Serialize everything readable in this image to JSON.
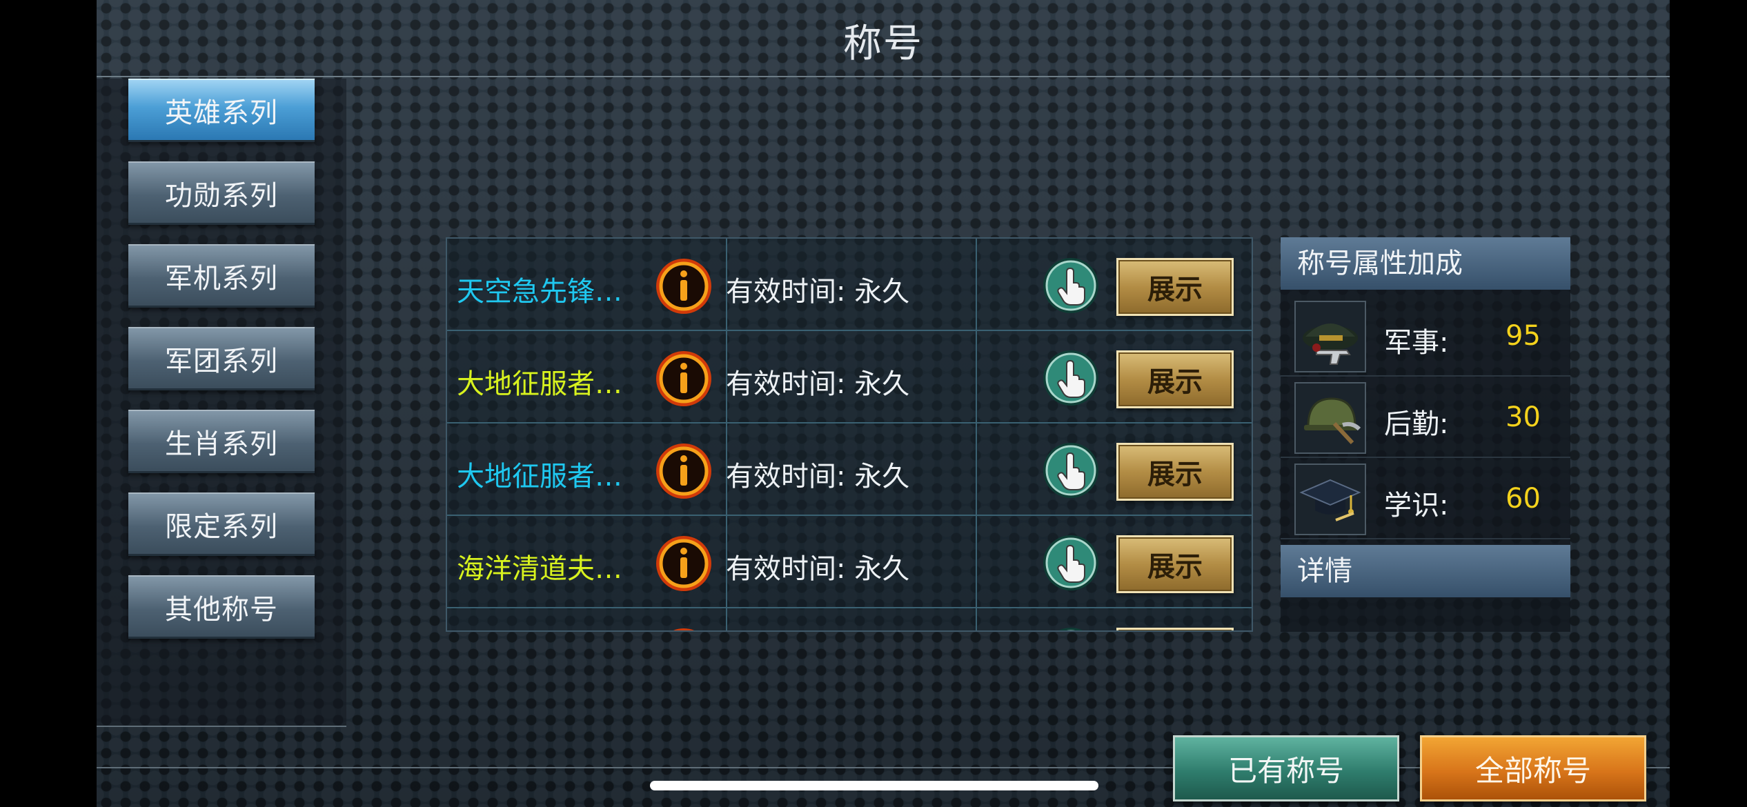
{
  "header": {
    "title": "称号",
    "close_icon": "close-x-icon"
  },
  "sidebar": {
    "items": [
      {
        "label": "英雄系列",
        "active": true
      },
      {
        "label": "功勋系列",
        "active": false
      },
      {
        "label": "军机系列",
        "active": false
      },
      {
        "label": "军团系列",
        "active": false
      },
      {
        "label": "生肖系列",
        "active": false
      },
      {
        "label": "限定系列",
        "active": false
      },
      {
        "label": "其他称号",
        "active": false
      }
    ]
  },
  "titles": {
    "rows": [
      {
        "name": "天空急先锋…",
        "name_color": "cyan",
        "validity": "有效时间: 永久",
        "show_label": "展示"
      },
      {
        "name": "大地征服者…",
        "name_color": "yellow",
        "validity": "有效时间: 永久",
        "show_label": "展示"
      },
      {
        "name": "大地征服者…",
        "name_color": "cyan",
        "validity": "有效时间: 永久",
        "show_label": "展示"
      },
      {
        "name": "海洋清道夫…",
        "name_color": "yellow",
        "validity": "有效时间: 永久",
        "show_label": "展示"
      }
    ],
    "icons": {
      "info": "info-icon",
      "select": "pointing-hand-icon"
    }
  },
  "attributes": {
    "header": "称号属性加成",
    "items": [
      {
        "label": "军事:",
        "value": "95",
        "icon": "officer-cap-pistol-icon"
      },
      {
        "label": "后勤:",
        "value": "30",
        "icon": "helmet-pickaxe-icon"
      },
      {
        "label": "学识:",
        "value": "60",
        "icon": "graduation-cap-icon"
      }
    ],
    "details_header": "详情"
  },
  "footer": {
    "owned_label": "已有称号",
    "all_label": "全部称号"
  },
  "colors": {
    "cyan_name": "#1fc8f0",
    "yellow_name": "#d8f21e",
    "value": "#f4d21c"
  }
}
